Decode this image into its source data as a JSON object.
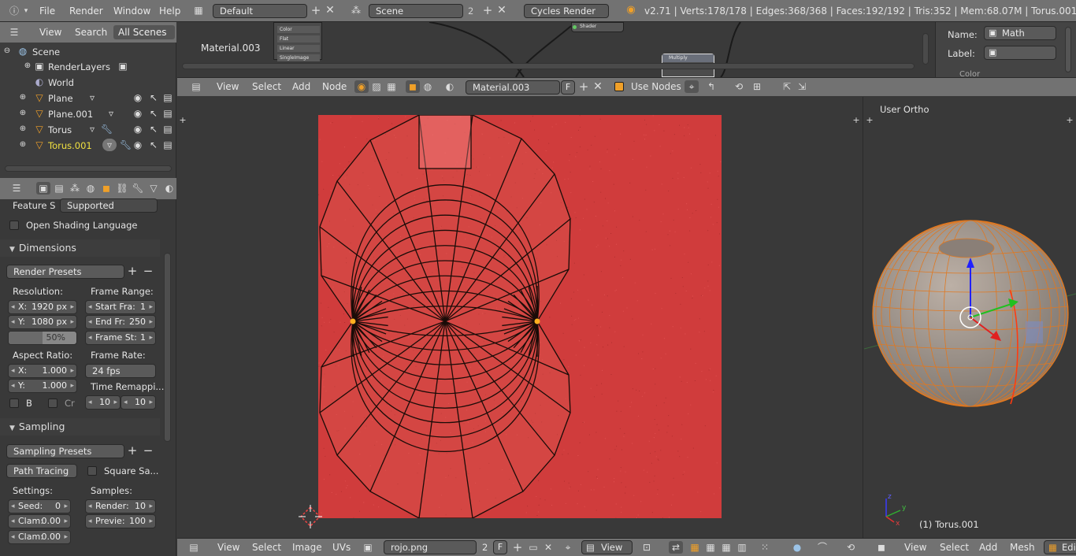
{
  "topbar": {
    "menus": [
      "File",
      "Render",
      "Window",
      "Help"
    ],
    "screen_layout": "Default",
    "scene": "Scene",
    "scene_users": "2",
    "engine": "Cycles Render",
    "stats": "v2.71 | Verts:178/178 | Edges:368/368 | Faces:192/192 | Tris:352 | Mem:68.07M | Torus.001"
  },
  "outliner": {
    "view_menu": "View",
    "search_menu": "Search",
    "scope": "All Scenes",
    "items": [
      {
        "label": "Scene"
      },
      {
        "label": "RenderLayers"
      },
      {
        "label": "World"
      },
      {
        "label": "Plane"
      },
      {
        "label": "Plane.001"
      },
      {
        "label": "Torus"
      },
      {
        "label": "Torus.001"
      }
    ]
  },
  "properties": {
    "feature_set_label": "Feature S",
    "feature_set_value": "Supported",
    "osl_label": "Open Shading Language",
    "dimensions": {
      "title": "Dimensions",
      "presets": "Render Presets",
      "resolution_label": "Resolution:",
      "res_x_name": "X:",
      "res_x": "1920 px",
      "res_y_name": "Y:",
      "res_y": "1080 px",
      "res_pct": "50%",
      "aspect_label": "Aspect Ratio:",
      "asp_x_name": "X:",
      "asp_x": "1.000",
      "asp_y_name": "Y:",
      "asp_y": "1.000",
      "border_label": "B",
      "crop_label": "Cr",
      "frame_range_label": "Frame Range:",
      "start_name": "Start Fra:",
      "start": "1",
      "end_name": "End Fr:",
      "end": "250",
      "step_name": "Frame St:",
      "step": "1",
      "frame_rate_label": "Frame Rate:",
      "fps": "24 fps",
      "time_remap_label": "Time Remappi...",
      "remap_old": "10",
      "remap_new": "10"
    },
    "sampling": {
      "title": "Sampling",
      "presets": "Sampling Presets",
      "method": "Path Tracing",
      "square_label": "Square Sa...",
      "settings_label": "Settings:",
      "seed_name": "Seed:",
      "seed": "0",
      "clamp1_name": "Clam:",
      "clamp1": "0.00",
      "clamp2_name": "Clam:",
      "clamp2": "0.00",
      "samples_label": "Samples:",
      "render_name": "Render:",
      "render": "10",
      "preview_name": "Previe:",
      "preview": "100"
    }
  },
  "node_editor": {
    "material_tab": "Material.003",
    "node_labels": [
      "Color",
      "Flat",
      "Linear",
      "SingleImage"
    ],
    "shader_label": "Shader",
    "multiply_label": "Multiply",
    "header_menus": [
      "View",
      "Select",
      "Add",
      "Node"
    ],
    "material": "Material.003",
    "fake_user": "F",
    "use_nodes_label": "Use Nodes"
  },
  "node_sidebar": {
    "name_label": "Name:",
    "name_value": "Math",
    "label_label": "Label:",
    "label_value": "",
    "color_panel": "Color"
  },
  "uv_editor": {
    "header_menus": [
      "View",
      "Select",
      "Image",
      "UVs"
    ],
    "image_name": "rojo.png",
    "image_users": "2",
    "fake_user": "F",
    "view_dropdown": "View",
    "background_color": "#d03c3c"
  },
  "viewport": {
    "view_name": "User Ortho",
    "object_label": "(1) Torus.001",
    "header_menus": [
      "View",
      "Select",
      "Add",
      "Mesh"
    ],
    "mode": "Edit"
  },
  "colors": {
    "accent": "#f0a028",
    "selected_object": "#f0e040",
    "bg": "#393939"
  }
}
